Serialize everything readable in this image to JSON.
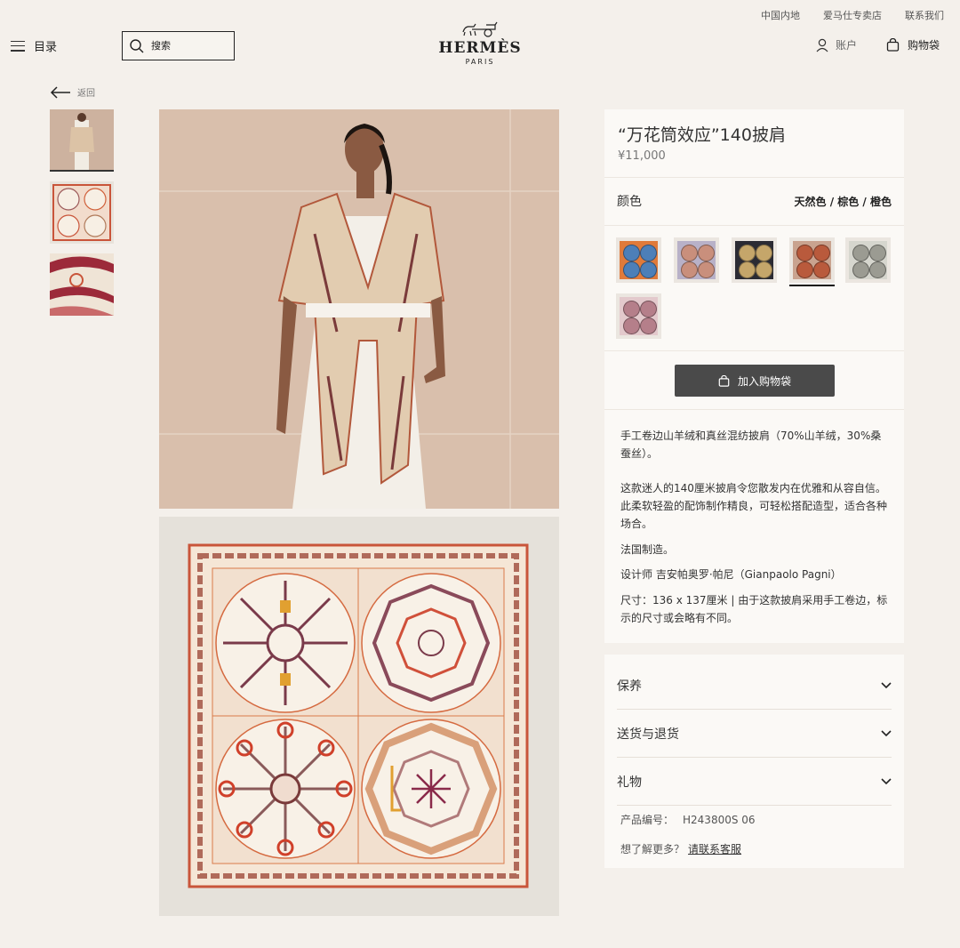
{
  "util_links": [
    "中国内地",
    "爱马仕专卖店",
    "联系我们"
  ],
  "header": {
    "menu_label": "目录",
    "search_placeholder": "搜索",
    "brand": "HERMÈS",
    "city": "PARIS",
    "account_label": "账户",
    "bag_label": "购物袋"
  },
  "back_label": "返回",
  "product": {
    "title": "“万花筒效应”140披肩",
    "price": "¥11,000",
    "color_label": "颜色",
    "color_value": "天然色 / 棕色 / 橙色",
    "swatches": [
      {
        "name": "orange-blue",
        "colors": [
          "#e07a3a",
          "#4d7fb8"
        ]
      },
      {
        "name": "lavender",
        "colors": [
          "#b8b1c8",
          "#c98f7c"
        ]
      },
      {
        "name": "black",
        "colors": [
          "#2b2b33",
          "#c5a66a"
        ]
      },
      {
        "name": "natural-brown-orange",
        "colors": [
          "#c9a38f",
          "#b95a3c"
        ]
      },
      {
        "name": "grey",
        "colors": [
          "#d6d6ce",
          "#9b9b92"
        ]
      },
      {
        "name": "pink",
        "colors": [
          "#e3c9cc",
          "#b57f8a"
        ]
      }
    ],
    "selected_swatch": 3,
    "add_to_bag": "加入购物袋",
    "desc_1": "手工卷边山羊绒和真丝混纺披肩（70%山羊绒，30%桑蚕丝）。",
    "desc_2": "这款迷人的140厘米披肩令您散发内在优雅和从容自信。此柔软轻盈的配饰制作精良，可轻松搭配造型，适合各种场合。",
    "desc_3": "法国制造。",
    "desc_4": "设计师 吉安帕奥罗·帕尼（Gianpaolo Pagni）",
    "desc_5": "尺寸：136 x 137厘米 | 由于这款披肩采用手工卷边，标示的尺寸或会略有不同。"
  },
  "accordion": [
    "保养",
    "送货与退货",
    "礼物"
  ],
  "meta": {
    "ref_label": "产品编号：",
    "ref_value": "H243800S 06",
    "help_label": "想了解更多？",
    "help_link": "请联系客服"
  },
  "colors": {
    "page_bg": "#f4f0eb",
    "panel_bg": "#fbf9f6",
    "button_bg": "#4a4a4a",
    "wall": "#d9bfac",
    "scarf_border": "#c9553a"
  }
}
